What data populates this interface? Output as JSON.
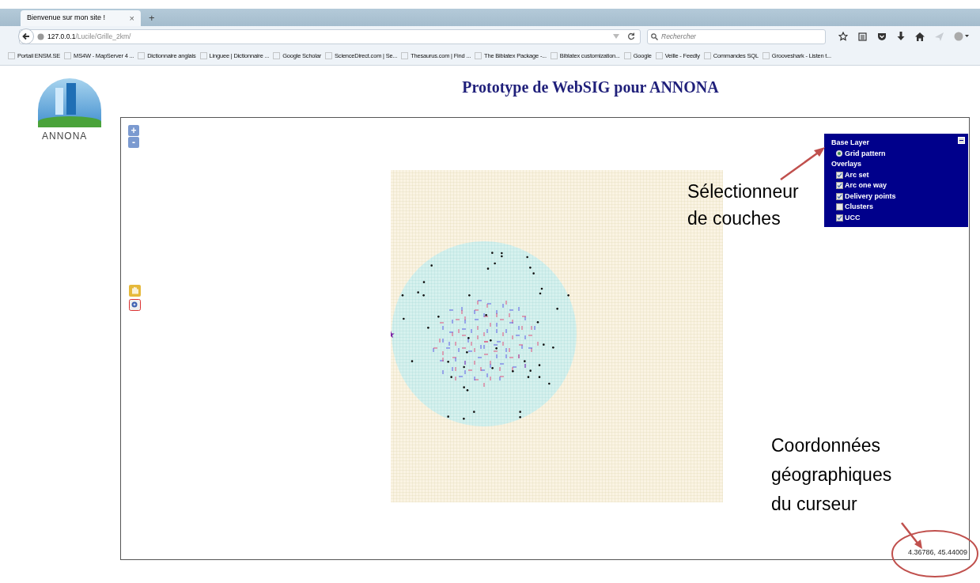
{
  "browser": {
    "tab": {
      "title": "Bienvenue sur mon site !",
      "close": "×"
    },
    "new_tab": "+",
    "address": {
      "host": "127.0.0.1",
      "path": "/Lucile/Grille_2km/"
    },
    "search": {
      "placeholder": "Rechercher"
    },
    "bookmarks": [
      "Portail ENSM.SE",
      "MS4W - MapServer 4 ...",
      "Dictionnaire anglais",
      "Linguee | Dictionnaire ...",
      "Google Scholar",
      "ScienceDirect.com | Se...",
      "Thesaurus.com | Find ...",
      "The Biblatex Package -...",
      "Biblatex customization...",
      "Google",
      "Veille - Feedly",
      "Commandes SQL",
      "Grooveshark - Listen t..."
    ]
  },
  "page": {
    "logo_text": "ANNONA",
    "title": "Prototype de WebSIG pour ANNONA"
  },
  "map": {
    "zoom_in": "+",
    "zoom_out": "-",
    "layer_switcher": {
      "base_heading": "Base Layer",
      "base_layers": [
        {
          "label": "Grid pattern",
          "selected": true
        }
      ],
      "overlay_heading": "Overlays",
      "overlays": [
        {
          "label": "Arc set",
          "checked": true
        },
        {
          "label": "Arc one way",
          "checked": true
        },
        {
          "label": "Delivery points",
          "checked": true
        },
        {
          "label": "Clusters",
          "checked": false
        },
        {
          "label": "UCC",
          "checked": true
        }
      ]
    },
    "mouse_position": "4.36786, 45.44009"
  },
  "annotations": [
    {
      "kind": "layers",
      "text": "Sélectionneur de couches"
    },
    {
      "kind": "coordinates",
      "text": "Coordonnées géographiques du curseur"
    }
  ]
}
